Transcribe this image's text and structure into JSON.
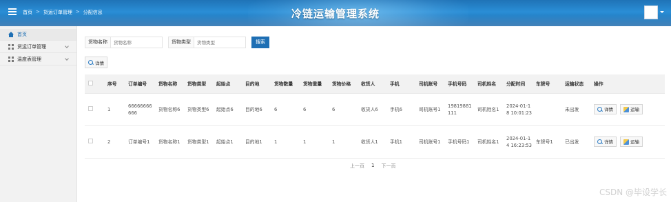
{
  "header": {
    "breadcrumbs": [
      "首页",
      "货运订单管理",
      "分配信息"
    ],
    "separator": ">",
    "system_title": "冷链运输管理系统"
  },
  "sidebar": {
    "items": [
      {
        "label": "首页",
        "icon": "home-icon"
      },
      {
        "label": "货运订单管理",
        "icon": "grid-icon"
      },
      {
        "label": "温度表管理",
        "icon": "grid-icon"
      }
    ]
  },
  "search": {
    "goods_name_label": "货物名称",
    "goods_name_placeholder": "货物名称",
    "goods_type_label": "货物类型",
    "goods_type_placeholder": "货物类型",
    "search_button": "搜索"
  },
  "toolbar": {
    "detail_label": "详情"
  },
  "table": {
    "headers": [
      "序号",
      "订单编号",
      "货物名称",
      "货物类型",
      "起始点",
      "目的地",
      "货物数量",
      "货物重量",
      "货物价格",
      "收货人",
      "手机",
      "司机账号",
      "手机号码",
      "司机姓名",
      "分配时间",
      "车牌号",
      "运输状态",
      "操作"
    ],
    "rows": [
      [
        "1",
        "66666666666",
        "货物名称6",
        "货物类型6",
        "起始点6",
        "目的地6",
        "6",
        "6",
        "6",
        "收货人6",
        "手机6",
        "司机账号1",
        "19819881111",
        "司机姓名1",
        "2024-01-18 10:01:23",
        "",
        "未出发"
      ],
      [
        "2",
        "订单编号1",
        "货物名称1",
        "货物类型1",
        "起始点1",
        "目的地1",
        "1",
        "1",
        "1",
        "收货人1",
        "手机1",
        "司机账号1",
        "手机号码1",
        "司机姓名1",
        "2024-01-14 16:23:53",
        "车牌号1",
        "已出发"
      ]
    ],
    "action_detail": "详情",
    "action_transport": "运输"
  },
  "pager": {
    "prev": "上一页",
    "current": "1",
    "next": "下一页"
  },
  "watermark": "CSDN @毕设学长",
  "colors": {
    "accent": "#1e6fb4",
    "header": "#1f73b7"
  }
}
